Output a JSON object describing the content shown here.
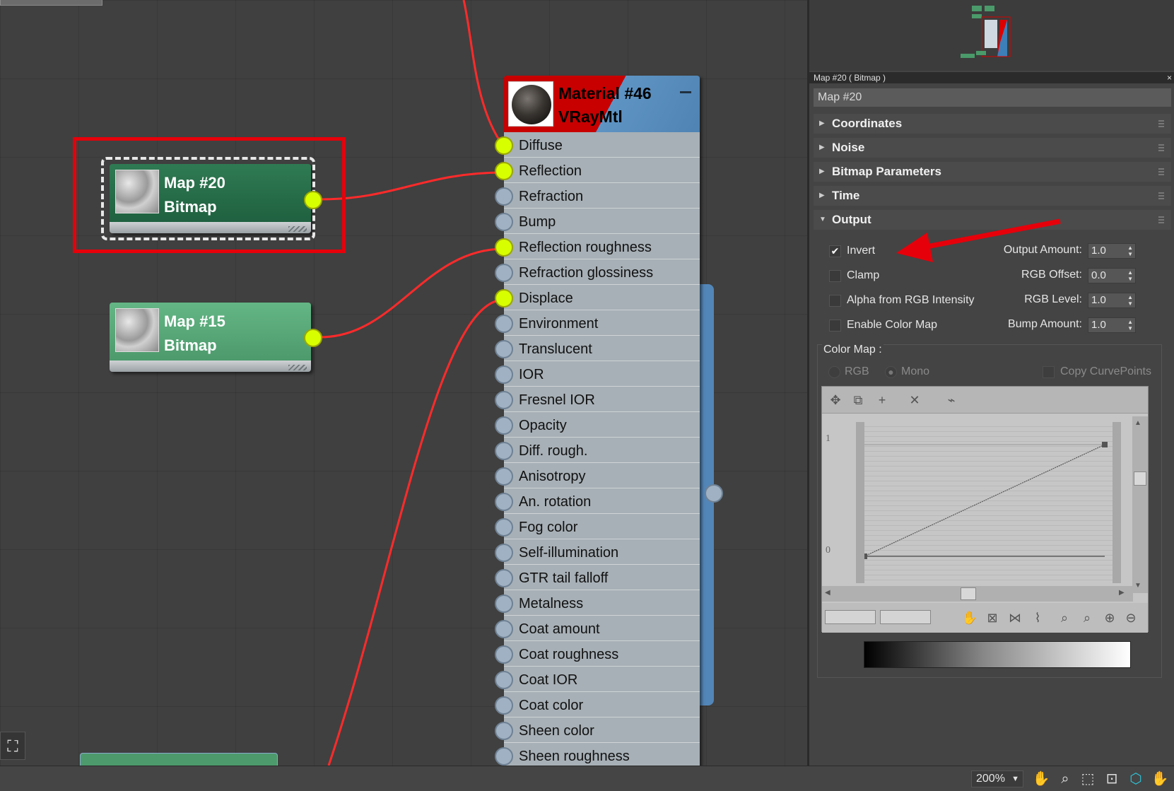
{
  "material_node": {
    "title": "Material #46",
    "type": "VRayMtl",
    "slots": [
      {
        "label": "Diffuse",
        "connected": true
      },
      {
        "label": "Reflection",
        "connected": true
      },
      {
        "label": "Refraction",
        "connected": false
      },
      {
        "label": "Bump",
        "connected": false
      },
      {
        "label": "Reflection roughness",
        "connected": true
      },
      {
        "label": "Refraction glossiness",
        "connected": false
      },
      {
        "label": "Displace",
        "connected": true
      },
      {
        "label": "Environment",
        "connected": false
      },
      {
        "label": "Translucent",
        "connected": false
      },
      {
        "label": "IOR",
        "connected": false
      },
      {
        "label": "Fresnel IOR",
        "connected": false
      },
      {
        "label": "Opacity",
        "connected": false
      },
      {
        "label": "Diff. rough.",
        "connected": false
      },
      {
        "label": "Anisotropy",
        "connected": false
      },
      {
        "label": "An. rotation",
        "connected": false
      },
      {
        "label": "Fog color",
        "connected": false
      },
      {
        "label": "Self-illumination",
        "connected": false
      },
      {
        "label": "GTR tail falloff",
        "connected": false
      },
      {
        "label": "Metalness",
        "connected": false
      },
      {
        "label": "Coat amount",
        "connected": false
      },
      {
        "label": "Coat roughness",
        "connected": false
      },
      {
        "label": "Coat IOR",
        "connected": false
      },
      {
        "label": "Coat color",
        "connected": false
      },
      {
        "label": "Sheen color",
        "connected": false
      },
      {
        "label": "Sheen roughness",
        "connected": false
      }
    ]
  },
  "map_nodes": {
    "map20": {
      "title": "Map #20",
      "type": "Bitmap"
    },
    "map15": {
      "title": "Map #15",
      "type": "Bitmap"
    }
  },
  "panel": {
    "header": "Map #20  ( Bitmap )",
    "close_glyph": "×",
    "map_name": "Map #20",
    "rollouts": {
      "coordinates": "Coordinates",
      "noise": "Noise",
      "bitmap_parameters": "Bitmap Parameters",
      "time": "Time",
      "output": "Output"
    },
    "output": {
      "invert": {
        "label": "Invert",
        "checked": true
      },
      "clamp": {
        "label": "Clamp",
        "checked": false
      },
      "alpha_from_rgb": {
        "label": "Alpha from RGB Intensity",
        "checked": false
      },
      "enable_color_map": {
        "label": "Enable Color Map",
        "checked": false
      },
      "output_amount": {
        "label": "Output Amount:",
        "value": "1.0"
      },
      "rgb_offset": {
        "label": "RGB Offset:",
        "value": "0.0"
      },
      "rgb_level": {
        "label": "RGB Level:",
        "value": "1.0"
      },
      "bump_amount": {
        "label": "Bump Amount:",
        "value": "1.0"
      }
    },
    "color_map": {
      "label": "Color Map :",
      "rgb": "RGB",
      "mono": "Mono",
      "copy_curve_points": "Copy CurvePoints",
      "y_max_label": "1",
      "y_min_label": "0"
    }
  },
  "status_bar": {
    "zoom": "200%"
  },
  "colors": {
    "highlight_red": "#e6000a",
    "socket_active": "#d8ff00",
    "wire": "#ff2a2a"
  }
}
